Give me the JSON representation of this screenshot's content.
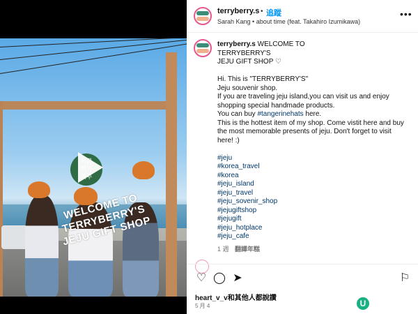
{
  "media": {
    "sign_text": "지금\n여기\n제주",
    "overlay_text": "WELCOME TO\nTERRYBERRY'S\nJEJU GIFT SHOP"
  },
  "header": {
    "username": "terryberry.s",
    "separator": "•",
    "follow_label": "追蹤",
    "audio_text": "Sarah Kang • about time (feat. Takahiro Izumikawa)",
    "more_icon": "more-horizontal-icon"
  },
  "caption": {
    "username": "terryberry.s",
    "title_line1": "WELCOME TO",
    "title_line2": "TERRYBERRY'S",
    "title_line3": "JEJU GIFT SHOP ♡",
    "line_hi": "Hi. This is \"TERRYBERRY'S\"",
    "line_souvenir": "Jeju souvenir shop.",
    "line_travel": "If you are traveling jeju island,you can visit us and enjoy shopping special handmade products.",
    "line_buy_prefix": "You can buy ",
    "line_buy_tag": "#tangerinehats",
    "line_buy_suffix": " here.",
    "line_hottest": "This is the hottest item of my shop. Come vistit here and buy the most memorable presents of jeju. Don't forget to visit here! :)",
    "hashtags": [
      "#jeju",
      "#korea_travel",
      "#korea",
      "#jeju_island",
      "#jeju_travel",
      "#jeju_sovenir_shop",
      "#jejugiftshop",
      "#jejugift",
      "#jeju_hotplace",
      "#jeju_cafe"
    ],
    "age": "1 週",
    "translate_label": "翻譯年糕"
  },
  "actions": {
    "like_icon": "heart-icon",
    "comment_icon": "comment-icon",
    "share_icon": "send-icon",
    "save_icon": "bookmark-icon"
  },
  "likes_text": "heart_v_v和其他人都說讚",
  "date_text": "5 月 4",
  "colors": {
    "link_blue": "#0095f6",
    "hashtag": "#00376b",
    "story_ring": "#e7578f"
  }
}
